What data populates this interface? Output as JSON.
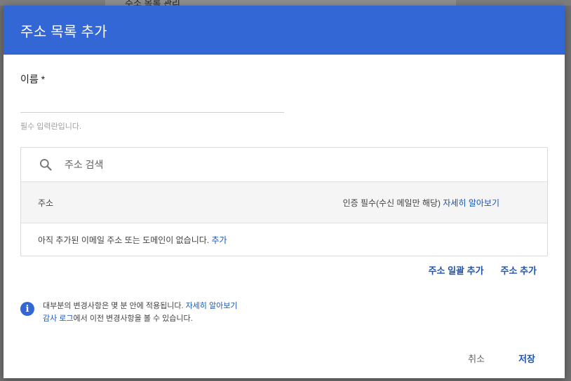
{
  "background": {
    "page_title": "주소 목록 관리"
  },
  "dialog": {
    "title": "주소 목록 추가",
    "name_label": "이름 *",
    "name_value": "",
    "helper_text": "필수 입력란입니다.",
    "search": {
      "placeholder": "주소 검색",
      "icon": "search-icon"
    },
    "table": {
      "col_address": "주소",
      "col_auth": "인증 필수(수신 메일만 해당)",
      "col_auth_link": "자세히 알아보기",
      "empty_text": "아직 추가된 이메일 주소 또는 도메인이 없습니다.",
      "empty_link": "추가"
    },
    "actions": {
      "bulk_add": "주소 일괄 추가",
      "add": "주소 추가"
    },
    "info": {
      "line1_text": "대부분의 변경사항은 몇 분 안에 적용됩니다.",
      "line1_link": "자세히 알아보기",
      "line2_link": "감사 로그",
      "line2_text": "에서 이전 변경사항을 볼 수 있습니다."
    },
    "footer": {
      "cancel": "취소",
      "save": "저장"
    }
  },
  "colors": {
    "header": "#3367d6",
    "link": "#1a55b5",
    "info_icon": "#3367d6"
  }
}
